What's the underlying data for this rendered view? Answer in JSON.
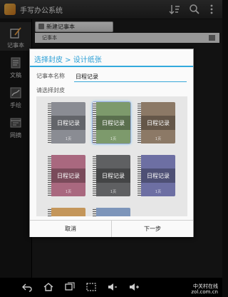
{
  "app": {
    "title": "手写办公系统",
    "colors": {
      "accent": "#33aadd",
      "action_bar": "#2f2f2f"
    },
    "actions": [
      "sort-icon",
      "search-icon",
      "overflow-menu-icon"
    ]
  },
  "sidebar": {
    "items": [
      {
        "label": "记事本",
        "icon": "pen-notebook-icon",
        "active": true
      },
      {
        "label": "文稿",
        "icon": "document-icon",
        "active": false
      },
      {
        "label": "手绘",
        "icon": "hand-drawing-icon",
        "active": false
      },
      {
        "label": "网摘",
        "icon": "web-clip-icon",
        "active": false
      }
    ]
  },
  "main": {
    "new_button_label": "新建记事本",
    "list_header_label": "记事本"
  },
  "dialog": {
    "title": "选择封皮 > 设计纸张",
    "name_label": "记事本名称",
    "name_value": "日程记录",
    "cover_label": "请选择封皮",
    "covers": [
      {
        "title": "日程记录",
        "page": "1页",
        "color": "#8a8c93",
        "selected": false
      },
      {
        "title": "日程记录",
        "page": "1页",
        "color": "#7d9a6c",
        "selected": true
      },
      {
        "title": "日程记录",
        "page": "1页",
        "color": "#8c7966",
        "selected": false
      },
      {
        "title": "日程记录",
        "page": "1页",
        "color": "#a9687f",
        "selected": false
      },
      {
        "title": "日程记录",
        "page": "1页",
        "color": "#5f6062",
        "selected": false
      },
      {
        "title": "日程记录",
        "page": "1页",
        "color": "#6d6fa3",
        "selected": false
      },
      {
        "title": "",
        "page": "",
        "color": "#c4965a",
        "selected": false
      },
      {
        "title": "",
        "page": "",
        "color": "#7d95ba",
        "selected": false
      }
    ],
    "cancel_label": "取消",
    "next_label": "下一步"
  },
  "navbar": {
    "icons": [
      "back-icon",
      "home-icon",
      "recent-apps-icon",
      "screenshot-icon",
      "volume-down-icon",
      "volume-up-icon"
    ],
    "watermark_line1": "中关村在线",
    "watermark_line2": "zol.com.cn"
  }
}
